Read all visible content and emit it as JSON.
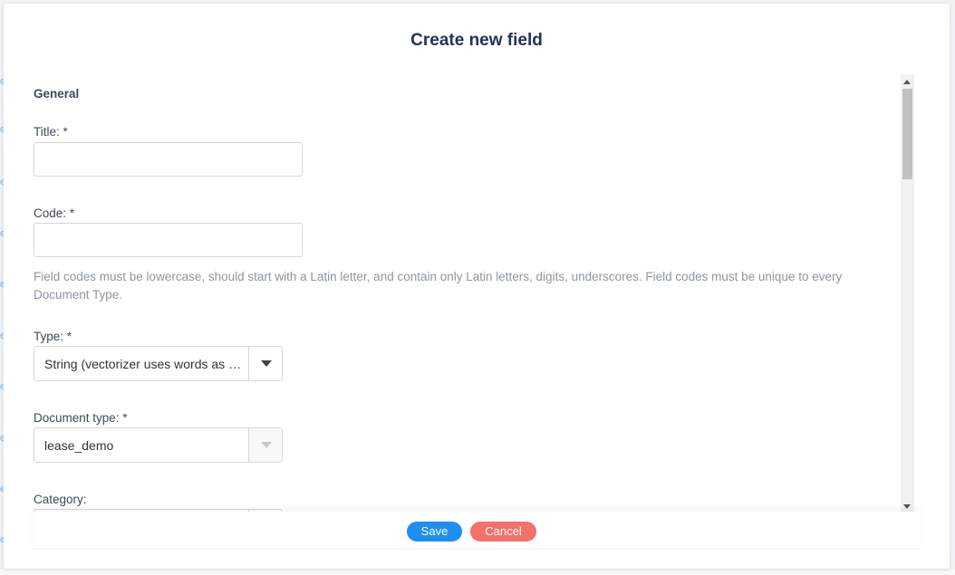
{
  "modal": {
    "title": "Create new field",
    "section_general": "General"
  },
  "fields": {
    "title": {
      "label": "Title: *",
      "value": "",
      "placeholder": ""
    },
    "code": {
      "label": "Code: *",
      "value": "",
      "placeholder": "",
      "help": "Field codes must be lowercase, should start with a Latin letter, and contain only Latin letters, digits, underscores. Field codes must be unique to every Document Type."
    },
    "type": {
      "label": "Type: *",
      "selected": "String (vectorizer uses words as …"
    },
    "document_type": {
      "label": "Document type: *",
      "selected": "lease_demo"
    },
    "category": {
      "label": "Category:",
      "selected": ""
    }
  },
  "footer": {
    "save_label": "Save",
    "cancel_label": "Cancel"
  },
  "colors": {
    "title": "#23325a",
    "save": "#1f8ef1",
    "cancel": "#f5706b",
    "help": "#8c96a6"
  }
}
